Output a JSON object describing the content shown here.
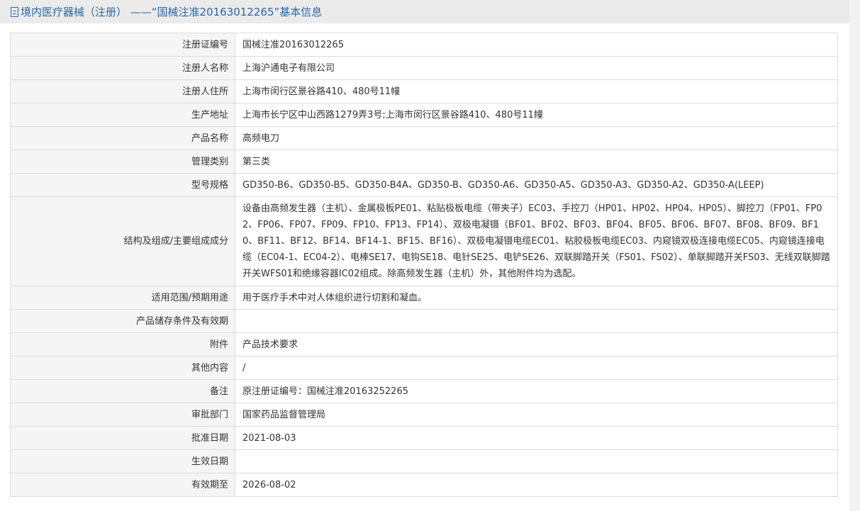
{
  "header": {
    "title": "境内医疗器械（注册） ——“国械注准20163012265”基本信息",
    "icon": "document-icon"
  },
  "fields": [
    {
      "label": "注册证编号",
      "value": "国械注准20163012265"
    },
    {
      "label": "注册人名称",
      "value": "上海沪通电子有限公司"
    },
    {
      "label": "注册人住所",
      "value": "上海市闵行区景谷路410、480号11幢"
    },
    {
      "label": "生产地址",
      "value": "上海市长宁区中山西路1279弄3号;上海市闵行区景谷路410、480号11幢"
    },
    {
      "label": "产品名称",
      "value": "高频电刀"
    },
    {
      "label": "管理类别",
      "value": "第三类"
    },
    {
      "label": "型号规格",
      "value": "GD350-B6、GD350-B5、GD350-B4A、GD350-B、GD350-A6、GD350-A5、GD350-A3、GD350-A2、GD350-A(LEEP)"
    },
    {
      "label": "结构及组成/主要组成成分",
      "value": "设备由高频发生器（主机）、金属极板PE01、粘贴极板电缆（带夹子）EC03、手控刀（HP01、HP02、HP04、HP05）、脚控刀（FP01、FP02、FP06、FP07、FP09、FP10、FP13、FP14）、双极电凝镊（BF01、BF02、BF03、BF04、BF05、BF06、BF07、BF08、BF09、BF10、BF11、BF12、BF14、BF14-1、BF15、BF16）、双极电凝镊电缆EC01、粘胶极板电缆EC03、内窥镜双极连接电缆EC05、内窥镜连接电缆（EC04-1、EC04-2）、电棒SE17、电钩SE18、电针SE25、电铲SE26、双联脚踏开关（FS01、FS02）、单联脚踏开关FS03、无线双联脚踏开关WFS01和绝缘容器IC02组成。除高频发生器（主机）外，其他附件均为选配。"
    },
    {
      "label": "适用范围/预期用途",
      "value": "用于医疗手术中对人体组织进行切割和凝血。"
    },
    {
      "label": "产品储存条件及有效期",
      "value": ""
    },
    {
      "label": "附件",
      "value": "产品技术要求"
    },
    {
      "label": "其他内容",
      "value": "/"
    },
    {
      "label": "备注",
      "value": "原注册证编号：国械注准20163252265"
    },
    {
      "label": "审批部门",
      "value": "国家药品监督管理局"
    },
    {
      "label": "批准日期",
      "value": "2021-08-03"
    },
    {
      "label": "生效日期",
      "value": ""
    },
    {
      "label": "有效期至",
      "value": "2026-08-02"
    }
  ]
}
